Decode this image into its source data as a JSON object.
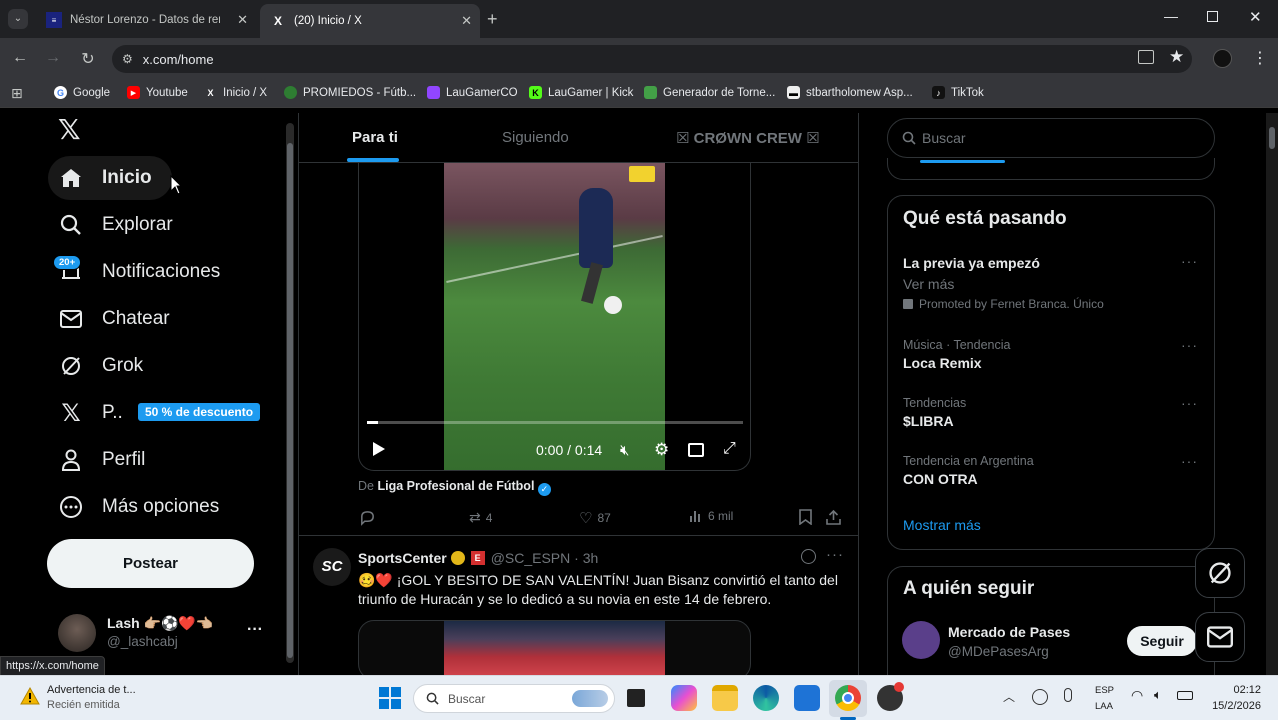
{
  "browser": {
    "tabs": [
      {
        "title": "Néstor Lorenzo - Datos de ren",
        "active": false
      },
      {
        "title": "(20) Inicio / X",
        "active": true
      }
    ],
    "url": "x.com/home",
    "bookmarks": [
      "Google",
      "Youtube",
      "Inicio / X",
      "PROMIEDOS - Fútb...",
      "LauGamerCO",
      "LauGamer | Kick",
      "Generador de Torne...",
      "stbartholomew Asp...",
      "TikTok"
    ],
    "status_url": "https://x.com/home"
  },
  "sidebar": {
    "items": [
      {
        "label": "Inicio",
        "icon": "home-icon"
      },
      {
        "label": "Explorar",
        "icon": "search-icon"
      },
      {
        "label": "Notificaciones",
        "icon": "bell-icon",
        "badge": "20+"
      },
      {
        "label": "Chatear",
        "icon": "mail-icon"
      },
      {
        "label": "Grok",
        "icon": "grok-icon"
      },
      {
        "label": "P..",
        "icon": "x-logo-icon",
        "badge": "50 % de descuento"
      },
      {
        "label": "Perfil",
        "icon": "person-icon"
      },
      {
        "label": "Más opciones",
        "icon": "more-circle-icon"
      }
    ],
    "post_button": "Postear",
    "account": {
      "name": "Lash 👉🏼⚽❤️👈🏼",
      "handle": "@_lashcabj",
      "more": "···"
    }
  },
  "timeline": {
    "tabs": [
      "Para ti",
      "Siguiendo",
      "☒ CRØWN CREW ☒"
    ],
    "video": {
      "time": "0:00 / 0:14",
      "progress": 0.0
    },
    "from_prefix": "De",
    "from_account": "Liga Profesional de Fútbol",
    "actions": {
      "replies": "",
      "reposts": "4",
      "likes": "87",
      "views": "6 mil"
    },
    "tweet2": {
      "name": "SportsCenter",
      "handle": "@SC_ESPN · 3h",
      "avatar_text": "SC",
      "text": "🥴❤️ ¡GOL Y BESITO DE SAN VALENTÍN! Juan Bisanz convirtió el tanto del triunfo de Huracán y se lo dedicó a su novia en este 14 de febrero."
    }
  },
  "right": {
    "search_placeholder": "Buscar",
    "whats_happening_title": "Qué está pasando",
    "trends": [
      {
        "context": "",
        "name": "La previa ya empezó",
        "extra": "Ver más",
        "promoted": "Promoted by Fernet Branca. Único"
      },
      {
        "context": "Música · Tendencia",
        "name": "Loca Remix"
      },
      {
        "context": "Tendencias",
        "name": "$LIBRA"
      },
      {
        "context": "Tendencia en Argentina",
        "name": "CON OTRA"
      }
    ],
    "show_more": "Mostrar más",
    "who_to_follow_title": "A quién seguir",
    "follow_suggestion": {
      "name": "Mercado de Pases",
      "handle": "@MDePasesArg",
      "button": "Seguir"
    }
  },
  "taskbar": {
    "weather_title": "Advertencia de t...",
    "weather_sub": "Recién emitida",
    "search_placeholder": "Buscar",
    "lang_top": "ESP",
    "lang_bottom": "LAA",
    "time": "02:12",
    "date": "15/2/2026"
  },
  "colors": {
    "accent": "#1d9bf0",
    "background": "#000000",
    "border": "#2f3336"
  }
}
